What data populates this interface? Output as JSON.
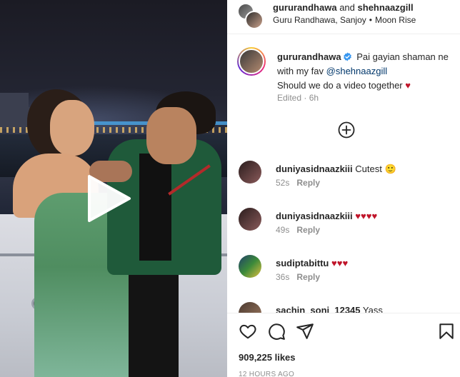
{
  "header": {
    "user1": "gururandhawa",
    "and_text": "and",
    "user2": "shehnaazgill",
    "collaborators": "Guru Randhawa, Sanjoy",
    "separator": "•",
    "audio": "Moon Rise"
  },
  "caption": {
    "username": "gururandhawa",
    "text_part1": "Pai gayian shaman ne with my fav",
    "mention": "@shehnaazgill",
    "text_part2": "Should we do a video together",
    "heart": "♥",
    "edited": "Edited · 6h"
  },
  "comments": [
    {
      "username": "duniyasidnaazkiii",
      "text": "Cutest 🙂",
      "time": "52s",
      "reply": "Reply",
      "avatar_color": "#5a3b3b"
    },
    {
      "username": "duniyasidnaazkiii",
      "text": "♥♥♥♥",
      "time": "49s",
      "reply": "Reply",
      "avatar_color": "#5a3b3b"
    },
    {
      "username": "sudiptabittu",
      "text": "♥♥♥",
      "time": "36s",
      "reply": "Reply",
      "avatar_color": "#3c6a3a"
    },
    {
      "username": "sachin_soni_12345",
      "text": "Yass",
      "time": "",
      "reply": "",
      "avatar_color": "#7a5a4a"
    }
  ],
  "actions": {
    "likes": "909,225 likes",
    "time": "12 HOURS AGO"
  },
  "icons": {
    "play": "play-icon",
    "add": "add-circle-icon",
    "like": "heart-icon",
    "comment": "comment-icon",
    "share": "share-icon",
    "save": "bookmark-icon",
    "verified": "verified-badge-icon"
  },
  "colors": {
    "verified": "#3897f0",
    "heart": "#c0152a",
    "mention": "#00376b",
    "muted": "#8e8e8e"
  }
}
